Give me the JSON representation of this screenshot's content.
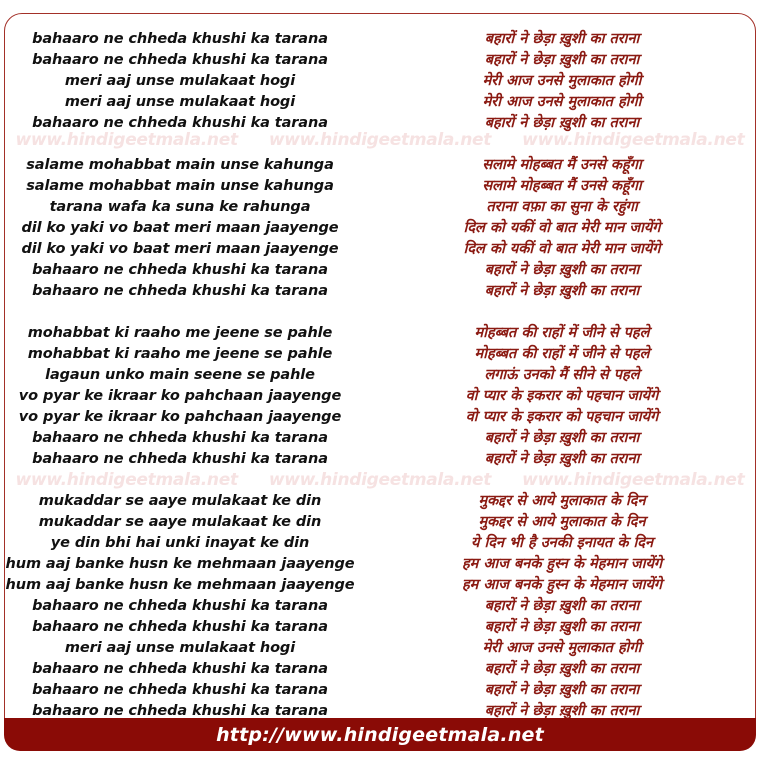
{
  "colors": {
    "frame_border": "#a33028",
    "roman_text": "#111111",
    "devanagari_text": "#8b1a12",
    "footer_background": "#8a0b06",
    "footer_text": "#ffffff",
    "watermark_text": "#f6e2e2",
    "page_background": "#ffffff"
  },
  "watermark": {
    "text": "www.hindigeetmala.net",
    "repeats_per_row": 3,
    "rows": 2
  },
  "footer": {
    "url_label": "http://www.hindigeetmala.net"
  },
  "lyrics": {
    "roman": {
      "stanzas": [
        [
          "bahaaro ne chheda khushi ka tarana",
          "bahaaro ne chheda khushi ka tarana",
          "meri aaj unse mulakaat hogi",
          "meri aaj unse mulakaat hogi",
          "bahaaro ne chheda khushi ka tarana"
        ],
        [
          "salame mohabbat main unse kahunga",
          "salame mohabbat main unse kahunga",
          "tarana wafa ka suna ke rahunga",
          "dil ko yaki vo baat meri maan jaayenge",
          "dil ko yaki vo baat meri maan jaayenge",
          "bahaaro ne chheda khushi ka tarana",
          "bahaaro ne chheda khushi ka tarana"
        ],
        [
          "mohabbat ki raaho me jeene se pahle",
          "mohabbat ki raaho me jeene se pahle",
          "lagaun unko main seene se pahle",
          "vo pyar ke ikraar ko pahchaan jaayenge",
          "vo pyar ke ikraar ko pahchaan jaayenge",
          "bahaaro ne chheda khushi ka tarana",
          "bahaaro ne chheda khushi ka tarana"
        ],
        [
          "mukaddar se aaye mulakaat ke din",
          "mukaddar se aaye mulakaat ke din",
          "ye din bhi hai unki inayat ke din",
          "hum aaj banke husn ke mehmaan jaayenge",
          "hum aaj banke husn ke mehmaan jaayenge",
          "bahaaro ne chheda khushi ka tarana",
          "bahaaro ne chheda khushi ka tarana",
          "meri aaj unse mulakaat hogi",
          "bahaaro ne chheda khushi ka tarana",
          "bahaaro ne chheda khushi ka tarana",
          "bahaaro ne chheda khushi ka tarana"
        ]
      ]
    },
    "devanagari": {
      "stanzas": [
        [
          "बहारों ने छेड़ा ख़ुशी का तराना",
          "बहारों ने छेड़ा ख़ुशी का तराना",
          "मेरी आज उनसे मुलाकात होगी",
          "मेरी आज उनसे मुलाकात होगी",
          "बहारों ने छेड़ा ख़ुशी का तराना"
        ],
        [
          "सलामे मोहब्बत मैं उनसे कहूँगा",
          "सलामे मोहब्बत मैं उनसे कहूँगा",
          "तराना वफ़ा का सुना के रहुंगा",
          "दिल को यकीं वो बात मेरी मान जायेंगे",
          "दिल को यकीं वो बात मेरी मान जायेंगे",
          "बहारों ने छेड़ा ख़ुशी का तराना",
          "बहारों ने छेड़ा ख़ुशी का तराना"
        ],
        [
          "मोहब्बत की राहों में जीने से पहले",
          "मोहब्बत की राहों में जीने से पहले",
          "लगाऊं उनको मैं सीने से पहले",
          "वो प्यार के इकरार को पहचान जायेंगे",
          "वो प्यार के इकरार को पहचान जायेंगे",
          "बहारों ने छेड़ा ख़ुशी का तराना",
          "बहारों ने छेड़ा ख़ुशी का तराना"
        ],
        [
          "मुकद्दर से आये मुलाकात के दिन",
          "मुकद्दर से आये मुलाकात के दिन",
          "ये दिन भी है उनकी इनायत के दिन",
          "हम आज बनके हुस्न के मेहमान जायेंगे",
          "हम आज बनके हुस्न के मेहमान जायेंगे",
          "बहारों ने छेड़ा ख़ुशी का तराना",
          "बहारों ने छेड़ा ख़ुशी का तराना",
          "मेरी आज उनसे मुलाकात होगी",
          "बहारों ने छेड़ा ख़ुशी का तराना",
          "बहारों ने छेड़ा ख़ुशी का तराना",
          "बहारों ने छेड़ा ख़ुशी का तराना"
        ]
      ]
    }
  }
}
